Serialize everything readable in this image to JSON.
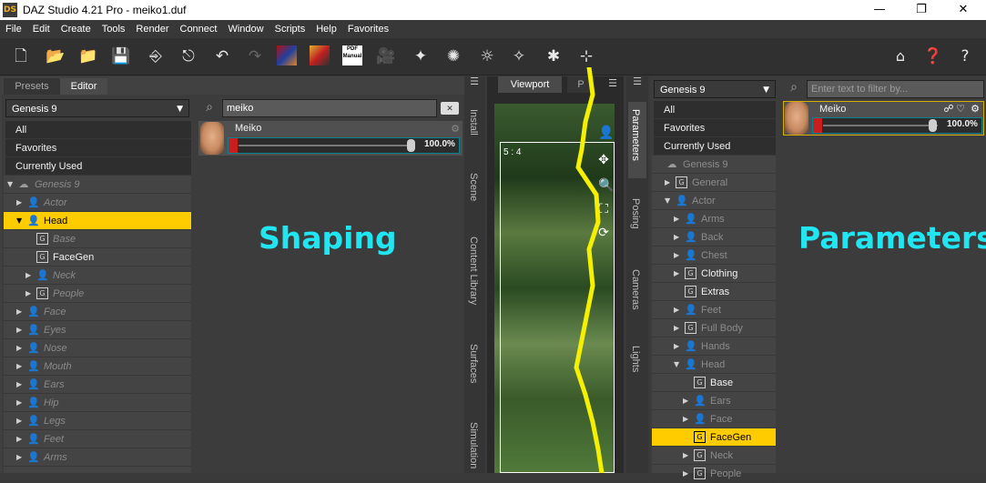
{
  "window": {
    "logo": "DS",
    "title": "DAZ Studio 4.21 Pro - meiko1.duf",
    "minimize": "—",
    "maximize": "❐",
    "close": "✕"
  },
  "menu": [
    "File",
    "Edit",
    "Create",
    "Tools",
    "Render",
    "Connect",
    "Window",
    "Scripts",
    "Help",
    "Favorites"
  ],
  "toolbar": {
    "pdf_label": "PDF Manual"
  },
  "left_panel": {
    "tabs": [
      "Presets",
      "Editor"
    ],
    "figure_select": "Genesis 9",
    "filters": [
      "All",
      "Favorites",
      "Currently Used"
    ],
    "tree": [
      {
        "label": "Genesis 9",
        "style": "grey"
      },
      {
        "label": "Actor",
        "style": "grey"
      },
      {
        "label": "Head",
        "style": "selected"
      },
      {
        "label": "Base",
        "style": "grey"
      },
      {
        "label": "FaceGen",
        "style": "white"
      },
      {
        "label": "Neck",
        "style": "grey"
      },
      {
        "label": "People",
        "style": "grey"
      },
      {
        "label": "Face",
        "style": "grey"
      },
      {
        "label": "Eyes",
        "style": "grey"
      },
      {
        "label": "Nose",
        "style": "grey"
      },
      {
        "label": "Mouth",
        "style": "grey"
      },
      {
        "label": "Ears",
        "style": "grey"
      },
      {
        "label": "Hip",
        "style": "grey"
      },
      {
        "label": "Legs",
        "style": "grey"
      },
      {
        "label": "Feet",
        "style": "grey"
      },
      {
        "label": "Arms",
        "style": "grey"
      }
    ],
    "search_value": "meiko",
    "morph": {
      "name": "Meiko",
      "value": "100.0%"
    },
    "overlay_label": "Shaping"
  },
  "side_tabs_left": [
    "Install",
    "Scene",
    "Content Library",
    "Surfaces",
    "Simulation"
  ],
  "viewport": {
    "tabs": [
      "Viewport",
      "P"
    ],
    "aspect": "5 : 4"
  },
  "side_tabs_right": [
    "Parameters",
    "Posing",
    "Cameras",
    "Lights"
  ],
  "right_panel": {
    "figure_select": "Genesis 9",
    "filters": [
      "All",
      "Favorites",
      "Currently Used"
    ],
    "tree": [
      {
        "label": "Genesis 9",
        "style": "dim"
      },
      {
        "label": "General",
        "style": "dim"
      },
      {
        "label": "Actor",
        "style": "dim"
      },
      {
        "label": "Arms",
        "style": "dim"
      },
      {
        "label": "Back",
        "style": "dim"
      },
      {
        "label": "Chest",
        "style": "dim"
      },
      {
        "label": "Clothing",
        "style": "white"
      },
      {
        "label": "Extras",
        "style": "white"
      },
      {
        "label": "Feet",
        "style": "dim"
      },
      {
        "label": "Full Body",
        "style": "dim"
      },
      {
        "label": "Hands",
        "style": "dim"
      },
      {
        "label": "Head",
        "style": "dim"
      },
      {
        "label": "Base",
        "style": "white"
      },
      {
        "label": "Ears",
        "style": "dim"
      },
      {
        "label": "Face",
        "style": "dim"
      },
      {
        "label": "FaceGen",
        "style": "selected"
      },
      {
        "label": "Neck",
        "style": "dim"
      },
      {
        "label": "People",
        "style": "dim"
      }
    ],
    "search_placeholder": "Enter text to filter by...",
    "morph": {
      "name": "Meiko",
      "value": "100.0%"
    },
    "overlay_label": "Parameters"
  },
  "colors": {
    "accent": "#ffcc00",
    "overlay": "#22e5f2",
    "slider": "#c81e1e",
    "annotation": "#f5f000"
  }
}
